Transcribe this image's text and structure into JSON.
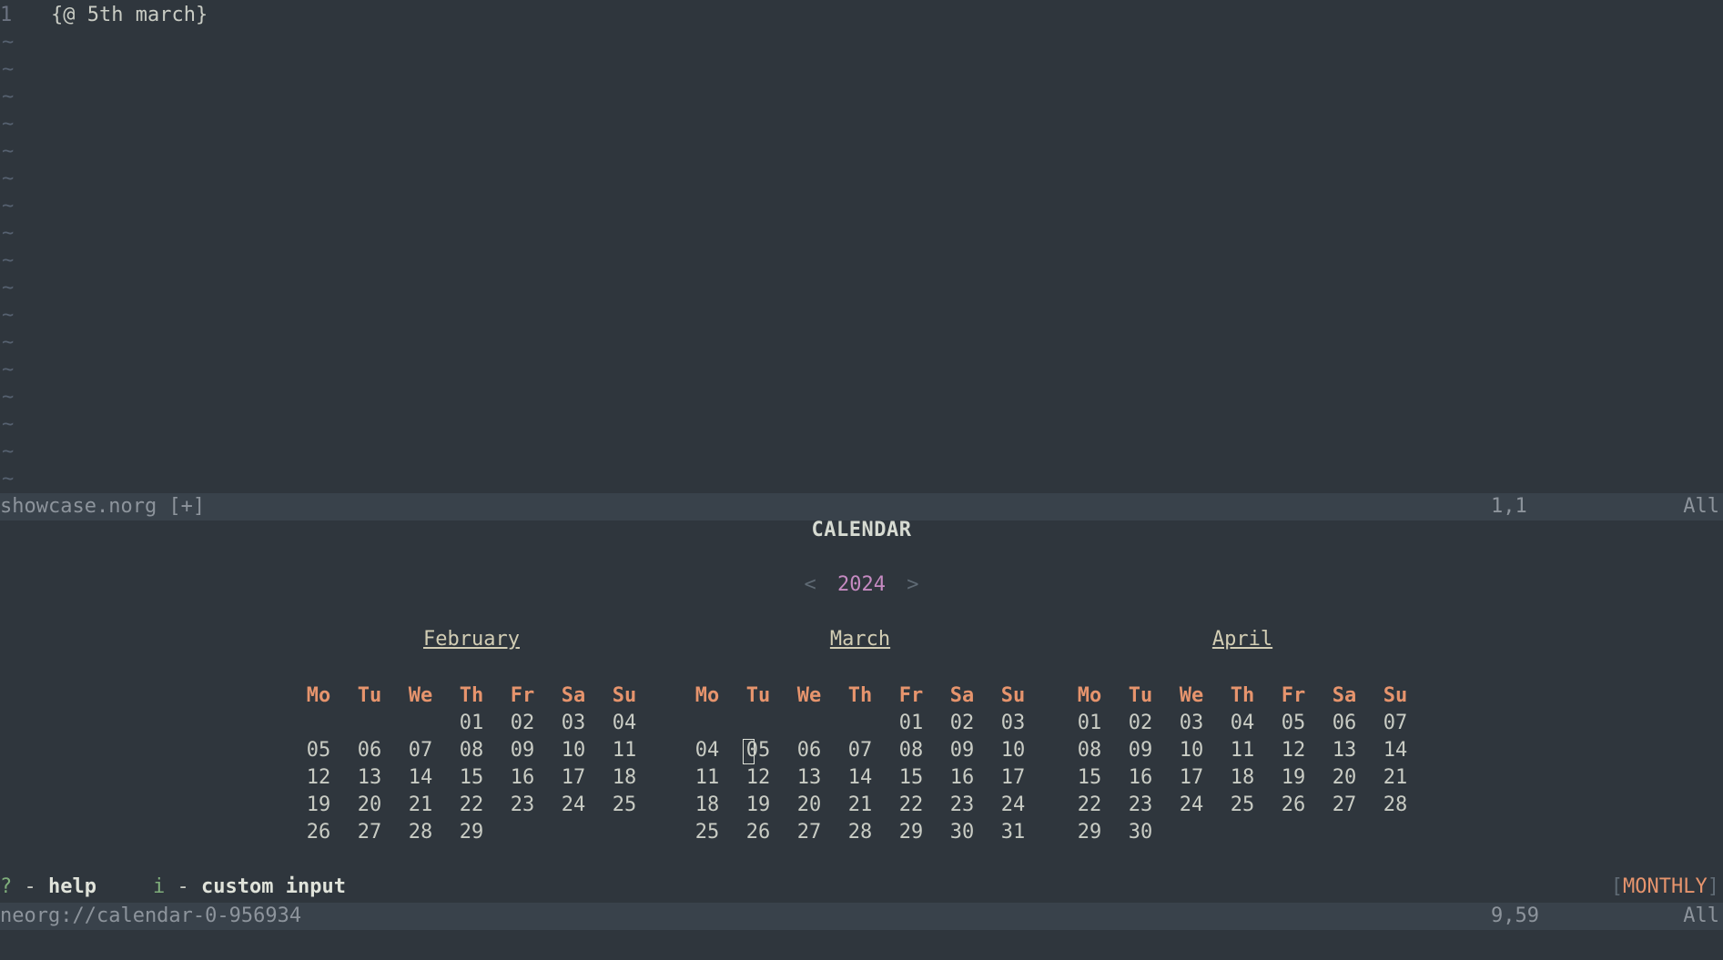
{
  "editor": {
    "line_number": "1",
    "line_text_open": "{@ ",
    "line_text_body": "5th march",
    "line_text_close": "}",
    "tilde": "~",
    "tilde_count": 17
  },
  "top_status": {
    "file": "showcase.norg [+]",
    "position": "1,1",
    "scroll": "All"
  },
  "calendar": {
    "title": "CALENDAR",
    "year": "2024",
    "prev_arrow": "<",
    "next_arrow": ">",
    "weekdays": [
      "Mo",
      "Tu",
      "We",
      "Th",
      "Fr",
      "Sa",
      "Su"
    ],
    "months": [
      {
        "name": "February",
        "weeks": [
          [
            "",
            "",
            "",
            "01",
            "02",
            "03",
            "04"
          ],
          [
            "05",
            "06",
            "07",
            "08",
            "09",
            "10",
            "11"
          ],
          [
            "12",
            "13",
            "14",
            "15",
            "16",
            "17",
            "18"
          ],
          [
            "19",
            "20",
            "21",
            "22",
            "23",
            "24",
            "25"
          ],
          [
            "26",
            "27",
            "28",
            "29",
            "",
            "",
            ""
          ]
        ]
      },
      {
        "name": "March",
        "weeks": [
          [
            "",
            "",
            "",
            "",
            "01",
            "02",
            "03"
          ],
          [
            "04",
            "05",
            "06",
            "07",
            "08",
            "09",
            "10"
          ],
          [
            "11",
            "12",
            "13",
            "14",
            "15",
            "16",
            "17"
          ],
          [
            "18",
            "19",
            "20",
            "21",
            "22",
            "23",
            "24"
          ],
          [
            "25",
            "26",
            "27",
            "28",
            "29",
            "30",
            "31"
          ]
        ]
      },
      {
        "name": "April",
        "weeks": [
          [
            "01",
            "02",
            "03",
            "04",
            "05",
            "06",
            "07"
          ],
          [
            "08",
            "09",
            "10",
            "11",
            "12",
            "13",
            "14"
          ],
          [
            "15",
            "16",
            "17",
            "18",
            "19",
            "20",
            "21"
          ],
          [
            "22",
            "23",
            "24",
            "25",
            "26",
            "27",
            "28"
          ],
          [
            "29",
            "30",
            "",
            "",
            "",
            "",
            ""
          ]
        ]
      }
    ],
    "selected": {
      "month": "March",
      "day": "05"
    }
  },
  "hints": {
    "help_key": "?",
    "help_label": "help",
    "input_key": "i",
    "input_label": "custom input",
    "separator": "-",
    "mode": "MONTHLY"
  },
  "bottom_status": {
    "buffer": "neorg://calendar-0-956934",
    "position": "9,59",
    "scroll": "All"
  },
  "colors": {
    "background": "#2f363d",
    "statusline": "#39424b",
    "weekday_header": "#e6946d",
    "year": "#c58ac1"
  }
}
